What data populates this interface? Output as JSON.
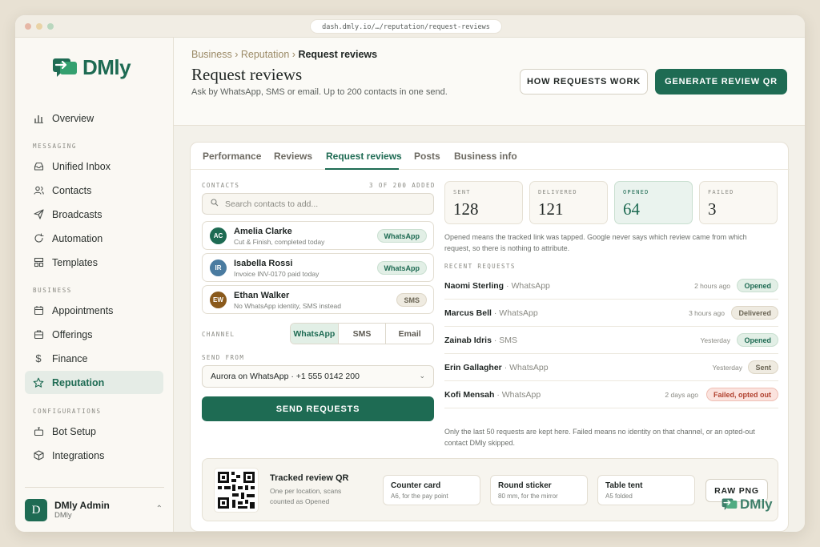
{
  "browser": {
    "url": "dash.dmly.io/…/reputation/request-reviews"
  },
  "brand": {
    "name": "DMly",
    "color": "#1e6b53"
  },
  "sidebar": {
    "overview": "Overview",
    "sections": {
      "messaging": "MESSAGING",
      "business": "BUSINESS",
      "configurations": "CONFIGURATIONS"
    },
    "messaging_items": [
      {
        "label": "Unified Inbox",
        "icon": "inbox-icon"
      },
      {
        "label": "Contacts",
        "icon": "contacts-icon"
      },
      {
        "label": "Broadcasts",
        "icon": "send-icon"
      },
      {
        "label": "Automation",
        "icon": "refresh-icon"
      },
      {
        "label": "Templates",
        "icon": "templates-icon"
      }
    ],
    "business_items": [
      {
        "label": "Appointments",
        "icon": "calendar-icon"
      },
      {
        "label": "Offerings",
        "icon": "briefcase-icon"
      },
      {
        "label": "Finance",
        "icon": "dollar-icon"
      },
      {
        "label": "Reputation",
        "icon": "star-icon",
        "active": true
      }
    ],
    "config_items": [
      {
        "label": "Bot Setup",
        "icon": "bot-icon"
      },
      {
        "label": "Integrations",
        "icon": "cube-icon"
      }
    ],
    "user": {
      "initial": "D",
      "name": "DMly Admin",
      "org": "DMly"
    }
  },
  "header": {
    "breadcrumb": [
      "Business ›",
      "Reputation ›",
      "Request reviews"
    ],
    "title": "Request reviews",
    "subtitle": "Ask by WhatsApp, SMS or email. Up to 200 contacts in one send.",
    "how_button": "HOW REQUESTS WORK",
    "generate_button": "GENERATE REVIEW QR"
  },
  "tabs": [
    "Performance",
    "Reviews",
    "Request reviews",
    "Posts",
    "Business info"
  ],
  "contacts": {
    "label": "CONTACTS",
    "count": "3 OF 200 ADDED",
    "search_placeholder": "Search contacts to add...",
    "list": [
      {
        "initials": "AC",
        "name": "Amelia Clarke",
        "sub": "Cut & Finish, completed today",
        "channel": "WhatsApp",
        "color": "#1e6b53"
      },
      {
        "initials": "IR",
        "name": "Isabella Rossi",
        "sub": "Invoice INV-0170 paid today",
        "channel": "WhatsApp",
        "color": "#4a7ba0"
      },
      {
        "initials": "EW",
        "name": "Ethan Walker",
        "sub": "No WhatsApp identity, SMS instead",
        "channel": "SMS",
        "color": "#8a5a1c"
      }
    ]
  },
  "channel": {
    "label": "CHANNEL",
    "options": [
      "WhatsApp",
      "SMS",
      "Email"
    ],
    "selected": "WhatsApp"
  },
  "send_from": {
    "label": "SEND FROM",
    "value": "Aurora on WhatsApp · +1 555 0142 200"
  },
  "send_button": "SEND REQUESTS",
  "stats": [
    {
      "label": "SENT",
      "value": "128"
    },
    {
      "label": "DELIVERED",
      "value": "121"
    },
    {
      "label": "OPENED",
      "value": "64"
    },
    {
      "label": "FAILED",
      "value": "3"
    }
  ],
  "stats_note": "Opened means the tracked link was tapped. Google never says which review came from which request, so there is nothing to attribute.",
  "recent": {
    "label": "RECENT REQUESTS",
    "rows": [
      {
        "name": "Naomi Sterling",
        "channel": "· WhatsApp",
        "time": "2 hours ago",
        "status": "Opened"
      },
      {
        "name": "Marcus Bell",
        "channel": "· WhatsApp",
        "time": "3 hours ago",
        "status": "Delivered"
      },
      {
        "name": "Zainab Idris",
        "channel": "· SMS",
        "time": "Yesterday",
        "status": "Opened"
      },
      {
        "name": "Erin Gallagher",
        "channel": "· WhatsApp",
        "time": "Yesterday",
        "status": "Sent"
      },
      {
        "name": "Kofi Mensah",
        "channel": "· WhatsApp",
        "time": "2 days ago",
        "status": "Failed, opted out"
      }
    ],
    "footnote": "Only the last 50 requests are kept here. Failed means no identity on that channel, or an opted-out contact DMly skipped."
  },
  "qr": {
    "title": "Tracked review QR",
    "subtitle": "One per location, scans counted as Opened",
    "cards": [
      {
        "title": "Counter card",
        "sub": "A6, for the pay point"
      },
      {
        "title": "Round sticker",
        "sub": "80 mm, for the mirror"
      },
      {
        "title": "Table tent",
        "sub": "A5 folded"
      }
    ],
    "raw_button": "RAW PNG"
  }
}
